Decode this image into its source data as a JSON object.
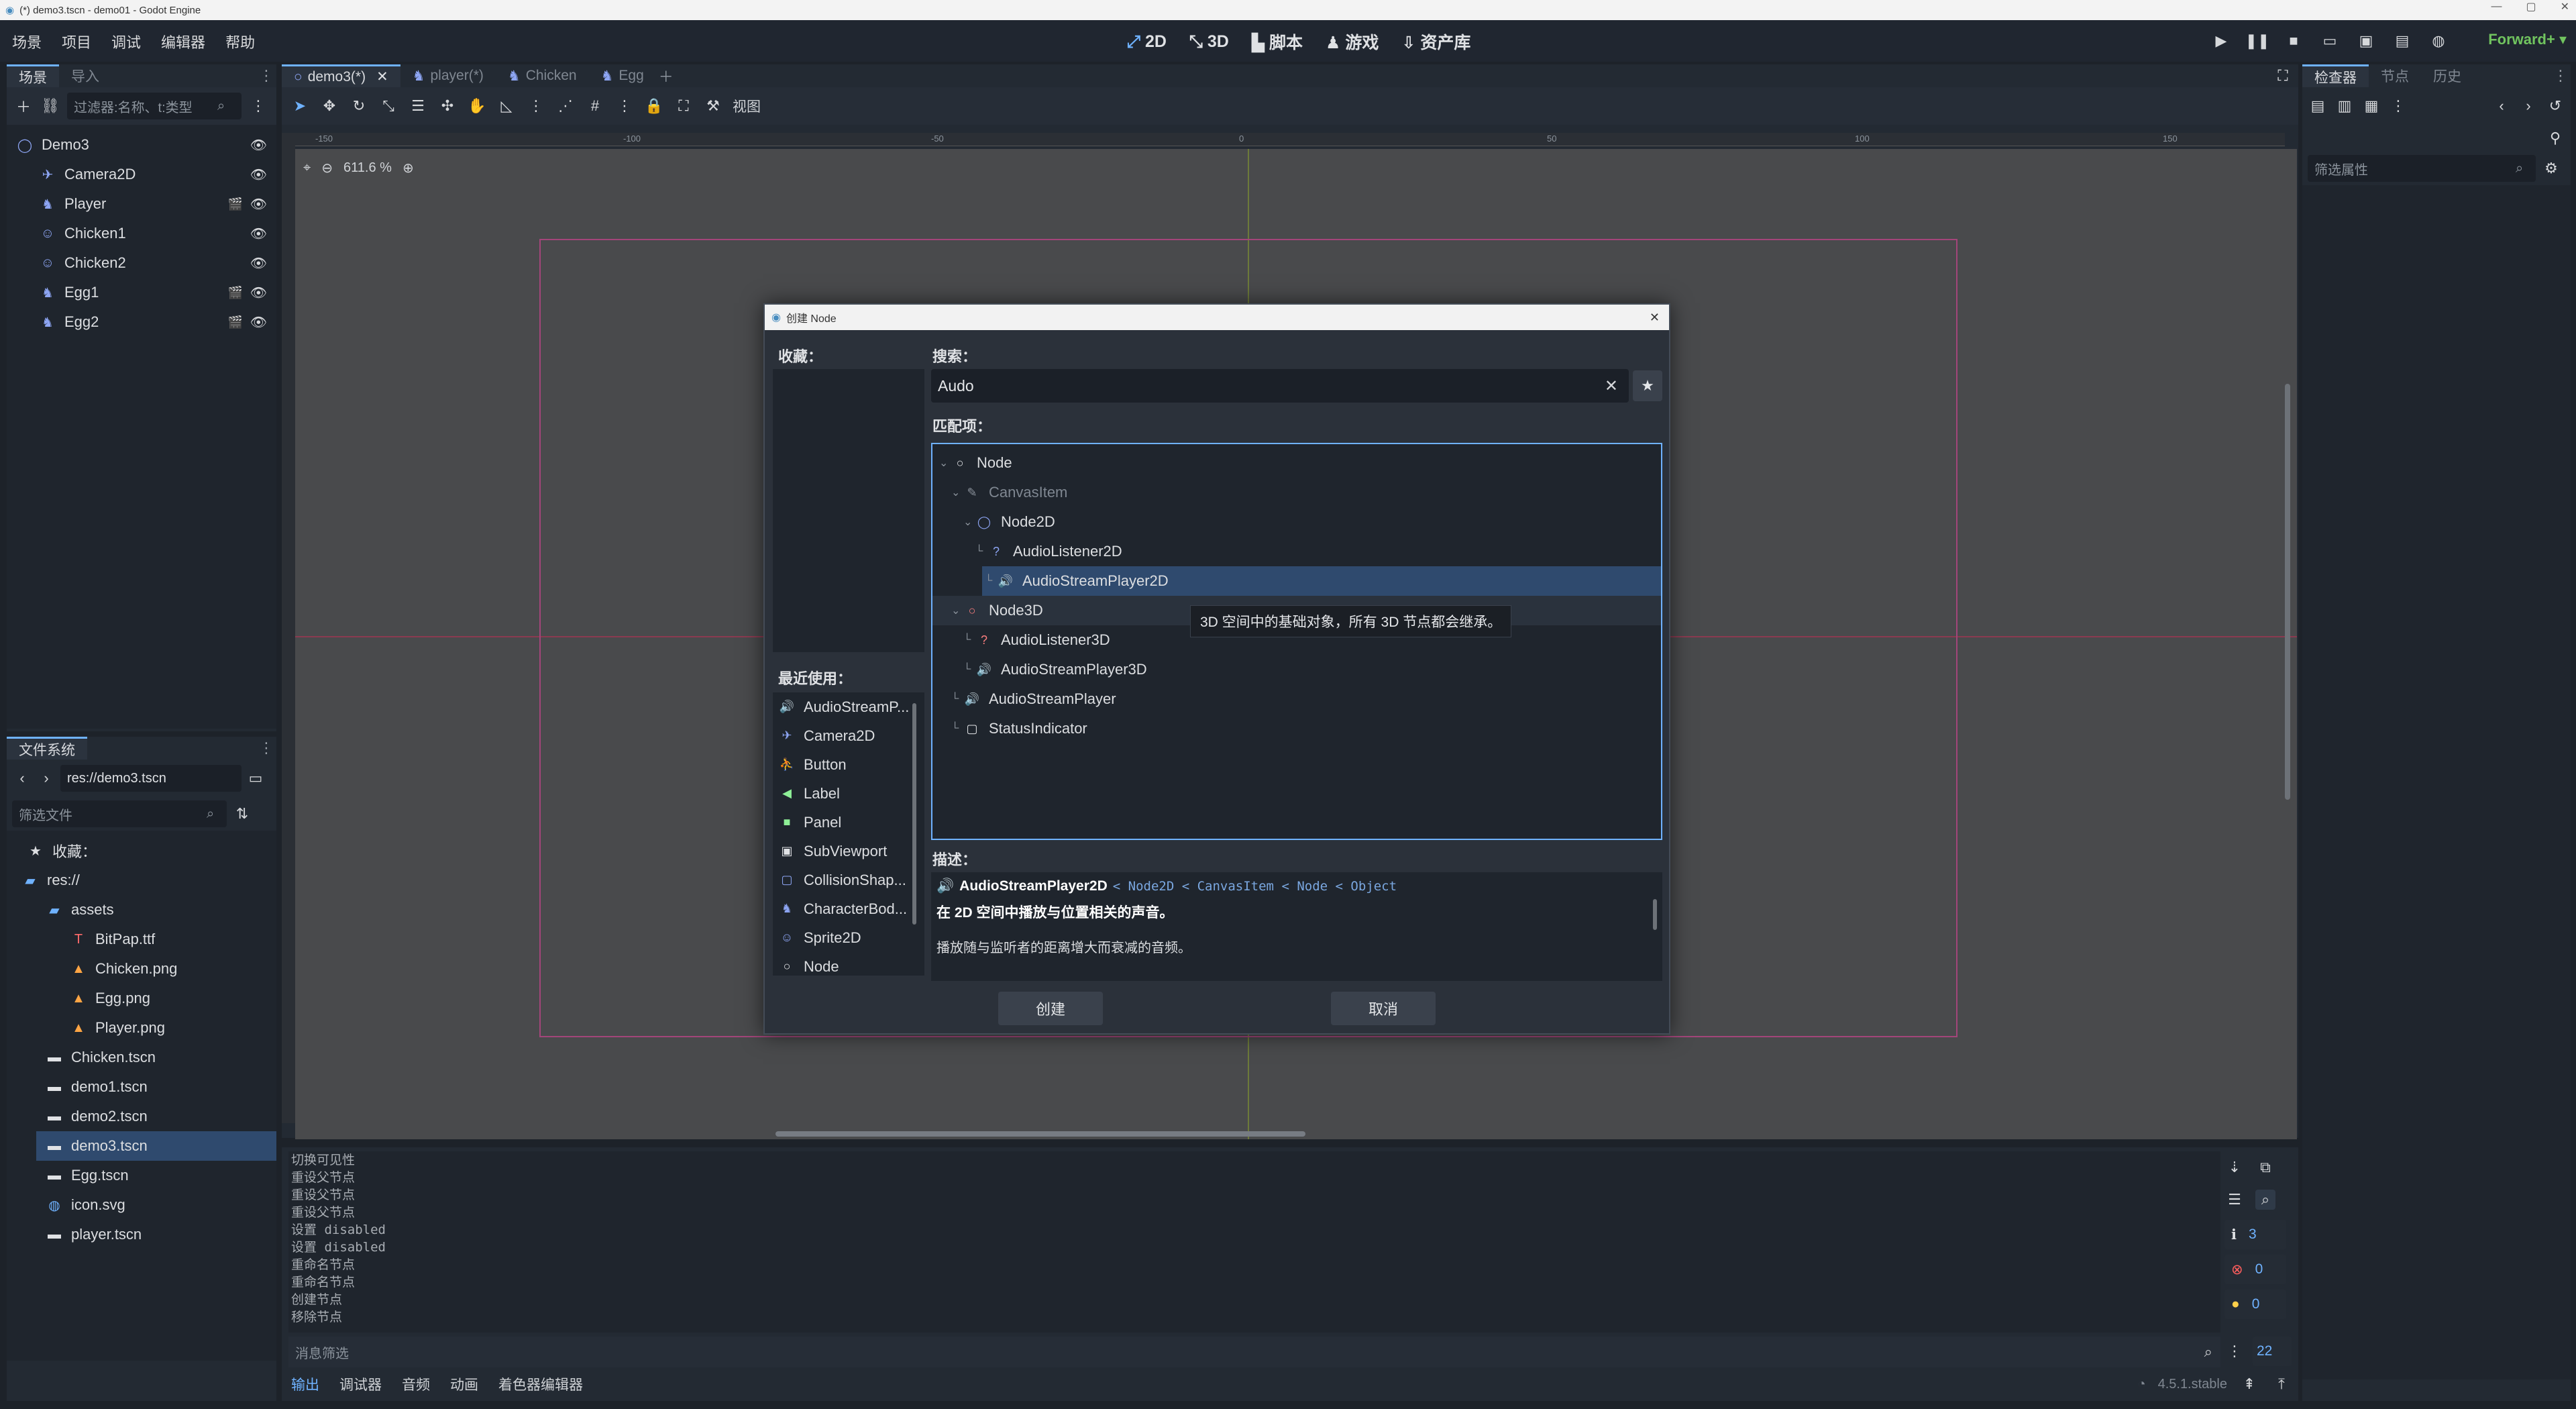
{
  "titlebar": {
    "title": "(*) demo3.tscn - demo01 - Godot Engine"
  },
  "menubar": {
    "menus": [
      "场景",
      "项目",
      "调试",
      "编辑器",
      "帮助"
    ],
    "modes": [
      "2D",
      "3D",
      "脚本",
      "游戏",
      "资产库"
    ],
    "renderer": "Forward+"
  },
  "scene_dock": {
    "tabs": [
      "场景",
      "导入"
    ],
    "filter_placeholder": "过滤器:名称、t:类型",
    "nodes": [
      {
        "name": "Demo3",
        "icon": "node2d-icon",
        "indent": 0
      },
      {
        "name": "Camera2D",
        "icon": "camera-icon",
        "indent": 1
      },
      {
        "name": "Player",
        "icon": "characterbody-icon",
        "indent": 1
      },
      {
        "name": "Chicken1",
        "icon": "sprite-icon",
        "indent": 1
      },
      {
        "name": "Chicken2",
        "icon": "sprite-icon",
        "indent": 1
      },
      {
        "name": "Egg1",
        "icon": "characterbody-icon",
        "indent": 1
      },
      {
        "name": "Egg2",
        "icon": "characterbody-icon",
        "indent": 1
      }
    ]
  },
  "filesystem": {
    "tab": "文件系统",
    "path": "res://demo3.tscn",
    "filter_placeholder": "筛选文件",
    "favorites": "收藏：",
    "items": [
      {
        "name": "res://",
        "indent": 0,
        "icon": "folder-icon"
      },
      {
        "name": "assets",
        "indent": 1,
        "icon": "folder-icon"
      },
      {
        "name": "BitPap.ttf",
        "indent": 2,
        "icon": "font-icon"
      },
      {
        "name": "Chicken.png",
        "indent": 2,
        "icon": "image-icon"
      },
      {
        "name": "Egg.png",
        "indent": 2,
        "icon": "image-icon"
      },
      {
        "name": "Player.png",
        "indent": 2,
        "icon": "image-icon"
      },
      {
        "name": "Chicken.tscn",
        "indent": 1,
        "icon": "scene-icon"
      },
      {
        "name": "demo1.tscn",
        "indent": 1,
        "icon": "scene-icon"
      },
      {
        "name": "demo2.tscn",
        "indent": 1,
        "icon": "scene-icon"
      },
      {
        "name": "demo3.tscn",
        "indent": 1,
        "icon": "scene-icon",
        "selected": true
      },
      {
        "name": "Egg.tscn",
        "indent": 1,
        "icon": "scene-icon"
      },
      {
        "name": "icon.svg",
        "indent": 1,
        "icon": "svg-icon"
      },
      {
        "name": "player.tscn",
        "indent": 1,
        "icon": "scene-icon"
      }
    ]
  },
  "editor_tabs": [
    "demo3(*)",
    "player(*)",
    "Chicken",
    "Egg"
  ],
  "viewport_toolbar": {
    "view": "视图",
    "zoom": "611.6 %"
  },
  "ruler_labels": [
    "-150",
    "-100",
    "-50",
    "0",
    "50",
    "100",
    "150"
  ],
  "inspector": {
    "tabs": [
      "检查器",
      "节点",
      "历史"
    ],
    "filter_placeholder": "筛选属性"
  },
  "dialog": {
    "title": "创建 Node",
    "favorites_label": "收藏：",
    "recent_label": "最近使用：",
    "recent": [
      "AudioStreamP...",
      "Camera2D",
      "Button",
      "Label",
      "Panel",
      "SubViewport",
      "CollisionShap...",
      "CharacterBod...",
      "Sprite2D",
      "Node"
    ],
    "search_label": "搜索：",
    "search_value": "Audo",
    "matches_label": "匹配项：",
    "tree": [
      {
        "name": "Node",
        "indent": 0,
        "icon": "node-icon"
      },
      {
        "name": "CanvasItem",
        "indent": 1,
        "icon": "canvasitem-icon",
        "dim": true
      },
      {
        "name": "Node2D",
        "indent": 2,
        "icon": "node2d-icon"
      },
      {
        "name": "AudioListener2D",
        "indent": 3,
        "icon": "audiolistener-icon"
      },
      {
        "name": "AudioStreamPlayer2D",
        "indent": 3,
        "icon": "speaker-icon",
        "selected": true
      },
      {
        "name": "Node3D",
        "indent": 1,
        "icon": "node3d-icon",
        "hover": true
      },
      {
        "name": "AudioListener3D",
        "indent": 2,
        "icon": "audiolistener3d-icon"
      },
      {
        "name": "AudioStreamPlayer3D",
        "indent": 2,
        "icon": "speaker3d-icon"
      },
      {
        "name": "AudioStreamPlayer",
        "indent": 1,
        "icon": "speaker-icon"
      },
      {
        "name": "StatusIndicator",
        "indent": 1,
        "icon": "statusindicator-icon"
      }
    ],
    "tooltip": "3D 空间中的基础对象，所有 3D 节点都会继承。",
    "description_label": "描述：",
    "desc_class": "AudioStreamPlayer2D",
    "desc_inherits": [
      "Node2D",
      "CanvasItem",
      "Node",
      "Object"
    ],
    "desc_line1": "在 2D 空间中播放与位置相关的声音。",
    "desc_line2": "播放随与监听者的距离增大而衰减的音频。",
    "create_button": "创建",
    "cancel_button": "取消"
  },
  "bottom_panel": {
    "log": [
      "切换可见性",
      "重设父节点",
      "重设父节点",
      "重设父节点",
      "设置 disabled",
      "设置 disabled",
      "重命名节点",
      "重命名节点",
      "创建节点",
      "移除节点"
    ],
    "filter_placeholder": "消息筛选",
    "tabs": [
      "输出",
      "调试器",
      "音频",
      "动画",
      "着色器编辑器"
    ],
    "counts": {
      "messages": "3",
      "errors": "0",
      "warnings": "0",
      "total": "22"
    },
    "version": "4.5.1.stable"
  }
}
